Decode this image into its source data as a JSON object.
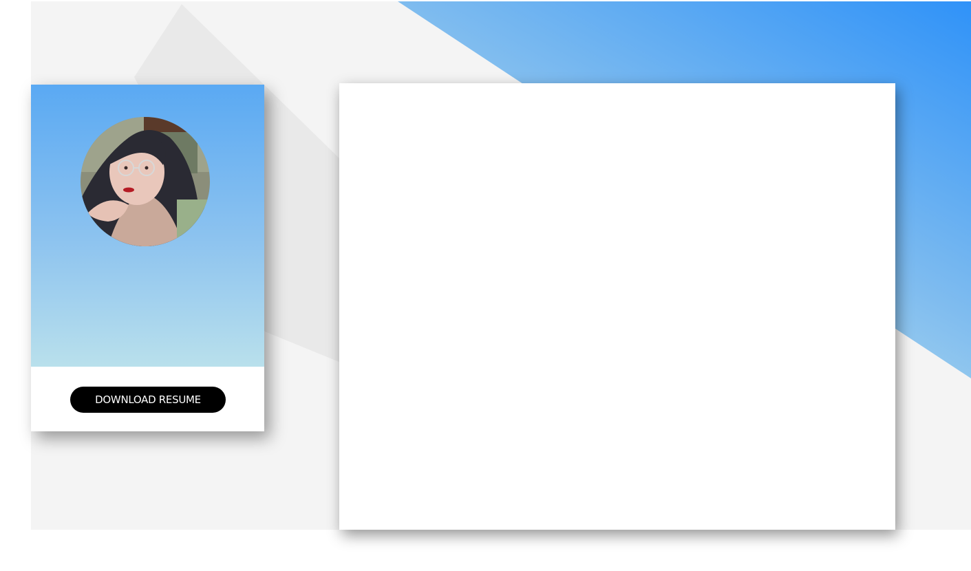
{
  "profile": {
    "avatar_icon": "portrait-photo",
    "download_label": "DOWNLOAD RESUME"
  },
  "colors": {
    "page_background": "#f4f4f4",
    "accent_blue": "#2f92f8",
    "accent_light": "#c4e6ed",
    "card_gradient_top": "#5aa9f3",
    "card_gradient_bottom": "#b9e0ec",
    "button_background": "#000000",
    "button_text": "#ffffff",
    "panel_background": "#ffffff"
  }
}
